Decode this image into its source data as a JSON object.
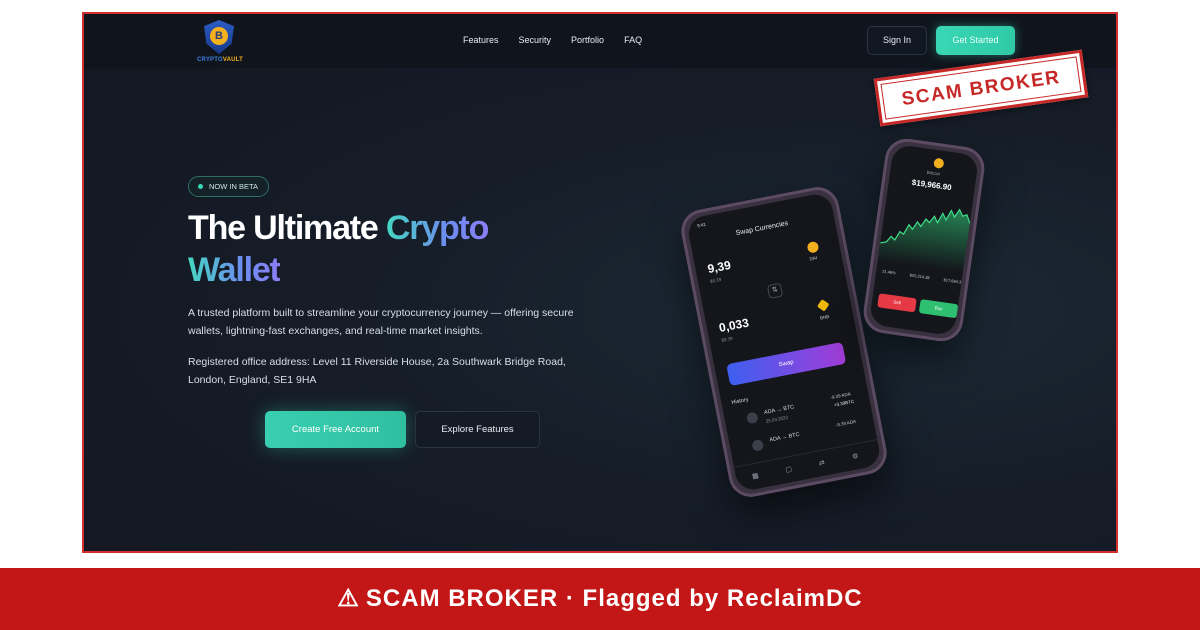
{
  "site": {
    "logo": {
      "coin_letter": "B",
      "wordmark_a": "CRYPTO",
      "wordmark_b": "VAULT"
    },
    "nav": {
      "links": [
        "Features",
        "Security",
        "Portfolio",
        "FAQ"
      ],
      "signin_label": "Sign In",
      "cta_label": "Get Started"
    },
    "hero": {
      "badge": "NOW IN BETA",
      "title_plain": "The Ultimate ",
      "title_accent_1": "Crypto",
      "title_accent_2": "Wallet",
      "description": "A trusted platform built to streamline your cryptocurrency journey — offering secure wallets, lightning-fast exchanges, and real-time market insights.",
      "address": "Registered office address: Level 11 Riverside House, 2a Southwark Bridge Road, London, England, SE1 9HA",
      "primary_cta": "Create Free Account",
      "secondary_cta": "Explore Features"
    },
    "phone_main": {
      "time": "9:41",
      "title": "Swap Currencies",
      "amount_1": "9,39",
      "amount_1_sub": "$9.39",
      "coin_1": "DAI",
      "amount_2": "0,033",
      "amount_2_sub": "$9.39",
      "coin_2": "BNB",
      "swap_label": "Swap",
      "history_label": "History",
      "history": [
        {
          "from": "ADA",
          "to": "BTC",
          "date": "25.03.2022",
          "amount": "-9.39 ADA",
          "amount2": "+3.39BTC"
        },
        {
          "from": "ADA",
          "to": "BTC",
          "date": "",
          "amount": "-9.39 ADA",
          "amount2": ""
        }
      ]
    },
    "phone_small": {
      "coin_name": "Bitcoin",
      "price": "$19,966.90",
      "stats": [
        "21.46%",
        "$20,314.38",
        "$17,664.37"
      ],
      "sell_label": "Sell",
      "buy_label": "Buy"
    }
  },
  "stamp": {
    "text": "SCAM BROKER"
  },
  "banner": {
    "icon": "⚠",
    "text": "SCAM BROKER · Flagged by ReclaimDC"
  },
  "colors": {
    "accent_teal": "#3ad7b5",
    "stamp_red": "#c62828",
    "banner_red": "#c31616",
    "background": "#141a24"
  }
}
